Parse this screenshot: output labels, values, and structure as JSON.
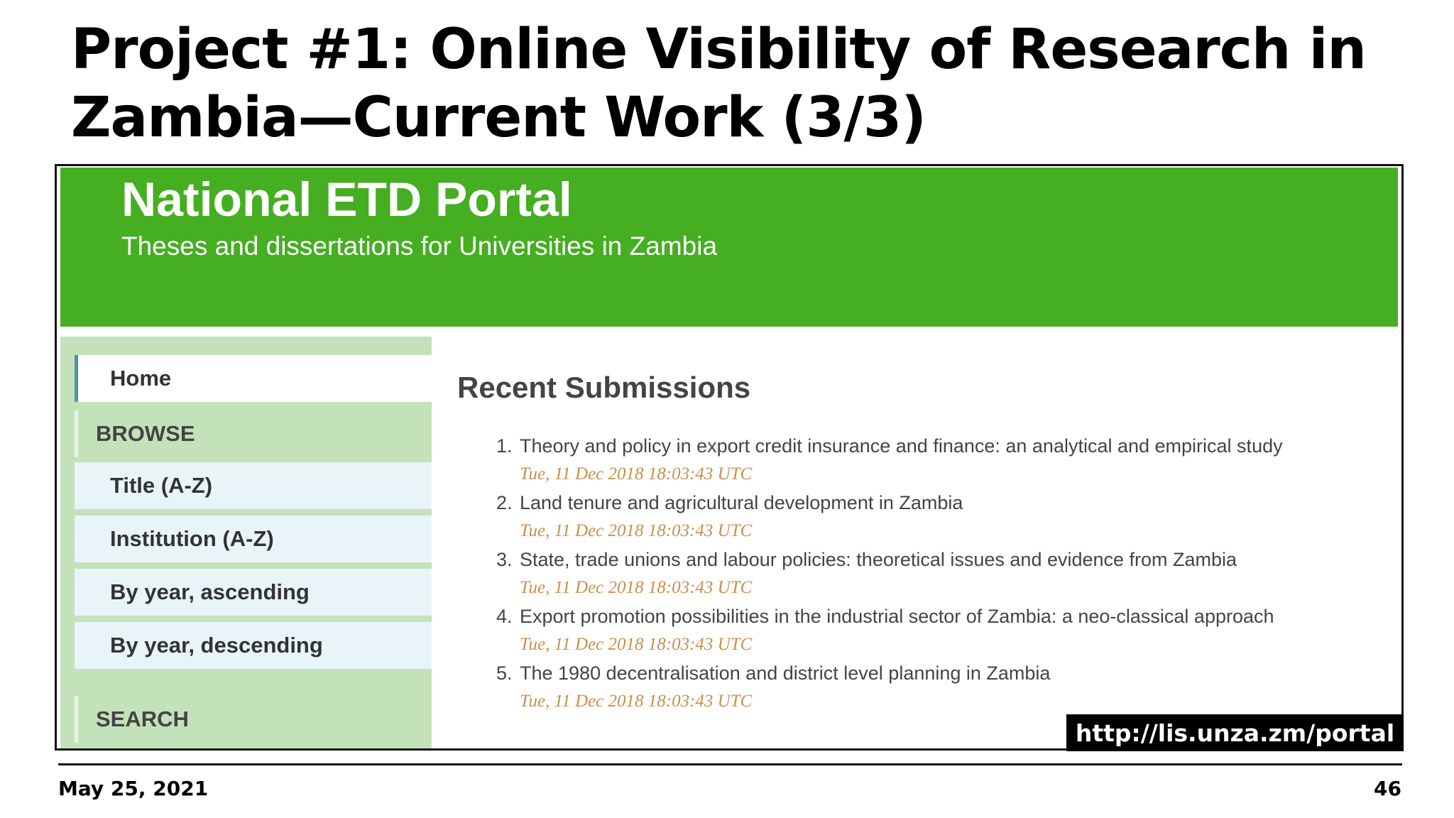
{
  "slide": {
    "title": "Project #1: Online Visibility of Research in Zambia—Current Work (3/3)",
    "footer_date": "May 25, 2021",
    "page_number": "46",
    "url_label": "http://lis.unza.zm/portal"
  },
  "portal": {
    "title": "National ETD Portal",
    "subtitle": "Theses and dissertations for Universities in Zambia",
    "header_color": "#45ae21",
    "sidebar_color": "#c4e2ba",
    "date_color": "#c98f4c"
  },
  "sidebar": {
    "home": "Home",
    "browse_heading": "BROWSE",
    "browse_items": [
      "Title (A-Z)",
      "Institution (A-Z)",
      "By year, ascending",
      "By year, descending"
    ],
    "search_heading": "SEARCH"
  },
  "main": {
    "heading": "Recent Submissions",
    "submissions": [
      {
        "num": "1.",
        "title": "Theory and policy in export credit insurance and finance: an analytical and empirical study",
        "date": "Tue, 11 Dec 2018 18:03:43 UTC"
      },
      {
        "num": "2.",
        "title": "Land tenure and agricultural development in Zambia",
        "date": "Tue, 11 Dec 2018 18:03:43 UTC"
      },
      {
        "num": "3.",
        "title": "State, trade unions and labour policies: theoretical issues and evidence from Zambia",
        "date": "Tue, 11 Dec 2018 18:03:43 UTC"
      },
      {
        "num": "4.",
        "title": "Export promotion possibilities in the industrial sector of Zambia: a neo-classical approach",
        "date": "Tue, 11 Dec 2018 18:03:43 UTC"
      },
      {
        "num": "5.",
        "title": "The 1980 decentralisation and district level planning in Zambia",
        "date": "Tue, 11 Dec 2018 18:03:43 UTC"
      }
    ]
  }
}
